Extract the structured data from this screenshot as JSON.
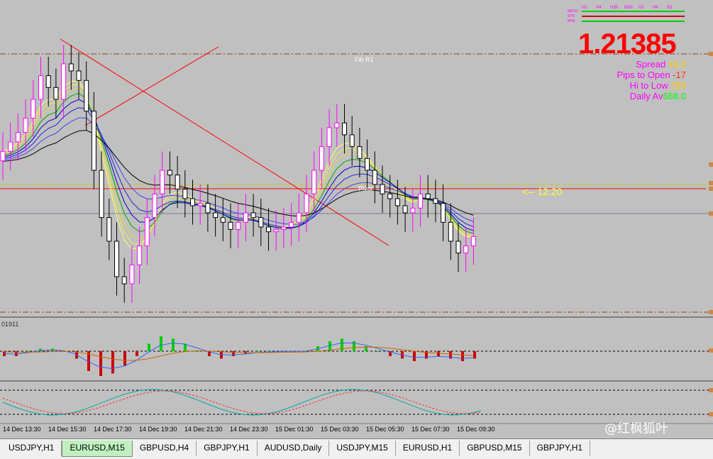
{
  "quote": {
    "price": "1.21385",
    "spread_label": "Spread",
    "spread_value": "18.0",
    "pips_open_label": "Pips to Open",
    "pips_open_value": "-17",
    "hi_low_label": "Hi to Low",
    "hi_low_value": "299",
    "daily_avg_label": "Daily Av",
    "daily_avg_value": "688.0"
  },
  "levels": {
    "fib_r1": "Fib R1",
    "pivot": "Pivot",
    "pivot_arrow": "<-- 12:20"
  },
  "oscillator": {
    "label": "01911"
  },
  "timeframe_bar": {
    "labels": [
      "H1",
      "H4",
      "H30",
      "M30",
      "H1",
      "H4",
      "D1"
    ],
    "indicators": [
      "MACD",
      "STR",
      "MVA"
    ]
  },
  "x_axis": {
    "ticks": [
      "14 Dec 13:30",
      "14 Dec 15:30",
      "14 Dec 17:30",
      "14 Dec 19:30",
      "14 Dec 21:30",
      "14 Dec 23:30",
      "15 Dec 01:30",
      "15 Dec 03:30",
      "15 Dec 05:30",
      "15 Dec 07:30",
      "15 Dec 09:30"
    ]
  },
  "tabs": [
    {
      "label": "USDJPY,H1",
      "active": false
    },
    {
      "label": "EURUSD,M15",
      "active": true
    },
    {
      "label": "GBPUSD,H4",
      "active": false
    },
    {
      "label": "GBPJPY,H1",
      "active": false
    },
    {
      "label": "AUDUSD,Daily",
      "active": false
    },
    {
      "label": "USDJPY,M15",
      "active": false
    },
    {
      "label": "EURUSD,H1",
      "active": false
    },
    {
      "label": "GBPUSD,M15",
      "active": false
    },
    {
      "label": "GBPJPY,H1",
      "active": false
    }
  ],
  "watermark": "@红枫狐叶",
  "colors": {
    "bull": "#ff00ff",
    "bear": "#000000",
    "spread_value": "#ffcc00",
    "pips_value": "#ff3300",
    "hilow_value": "#ffcc00",
    "daily_value": "#00ff00"
  },
  "chart_data": {
    "type": "candlestick",
    "closes": [
      1.2138,
      1.2142,
      1.2146,
      1.2152,
      1.216,
      1.217,
      1.2165,
      1.216,
      1.2175,
      1.2172,
      1.2168,
      1.2155,
      1.213,
      1.211,
      1.21,
      1.2085,
      1.2082,
      1.209,
      1.2098,
      1.211,
      1.212,
      1.213,
      1.2128,
      1.2122,
      1.2118,
      1.2115,
      1.2116,
      1.2112,
      1.211,
      1.2108,
      1.2105,
      1.2108,
      1.2112,
      1.211,
      1.2106,
      1.2104,
      1.2105,
      1.2106,
      1.2108,
      1.2112,
      1.212,
      1.213,
      1.214,
      1.2148,
      1.215,
      1.2145,
      1.214,
      1.2135,
      1.213,
      1.2124,
      1.212,
      1.2118,
      1.2115,
      1.2112,
      1.2114,
      1.212,
      1.2118,
      1.2116,
      1.2108,
      1.21,
      1.2095,
      1.2098,
      1.2102
    ],
    "macd_hist": [
      -0.2,
      -0.2,
      0,
      0.1,
      0.1,
      0,
      -0.3,
      -0.8,
      -1,
      -0.9,
      -0.6,
      -0.2,
      0.3,
      0.6,
      0.5,
      0.3,
      0,
      -0.2,
      -0.3,
      -0.2,
      -0.1,
      0,
      0,
      0,
      0,
      0,
      0.2,
      0.4,
      0.5,
      0.4,
      0.2,
      0,
      -0.2,
      -0.3,
      -0.4,
      -0.3,
      -0.2,
      -0.3,
      -0.4,
      -0.3
    ]
  }
}
